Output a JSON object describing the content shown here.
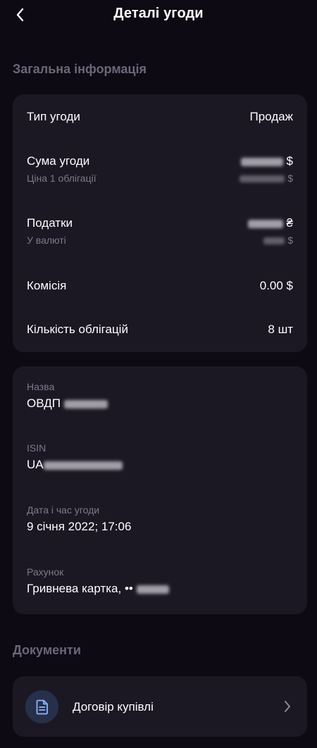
{
  "header": {
    "title": "Деталі угоди",
    "back_icon": "chevron-left-icon"
  },
  "general": {
    "section_title": "Загальна інформація",
    "deal_type_label": "Тип угоди",
    "deal_type_value": "Продаж",
    "amount_label": "Сума угоди",
    "amount_currency": "$",
    "price_label": "Ціна 1 облігації",
    "price_currency": "$",
    "taxes_label": "Податки",
    "taxes_currency": "₴",
    "in_currency_label": "У валюті",
    "in_currency_currency": "$",
    "commission_label": "Комісія",
    "commission_value": "0.00 $",
    "bonds_count_label": "Кількість облігацій",
    "bonds_count_value": "8 шт"
  },
  "details": {
    "name_label": "Назва",
    "name_prefix": "ОВДП",
    "isin_label": "ISIN",
    "isin_prefix": "UA",
    "datetime_label": "Дата і час угоди",
    "datetime_value": "9 січня 2022; 17:06",
    "account_label": "Рахунок",
    "account_prefix": "Гривнева картка, ••"
  },
  "documents": {
    "section_title": "Документи",
    "contract_label": "Договір купівлі",
    "contract_icon": "document-icon",
    "chevron_icon": "chevron-right-icon"
  },
  "colors": {
    "background": "#0d0a14",
    "card": "#1b1824",
    "muted_text": "#7d7989",
    "section_title": "#6b6778",
    "doc_icon_bg": "#26304a",
    "doc_icon_fg": "#8fb4ff"
  }
}
